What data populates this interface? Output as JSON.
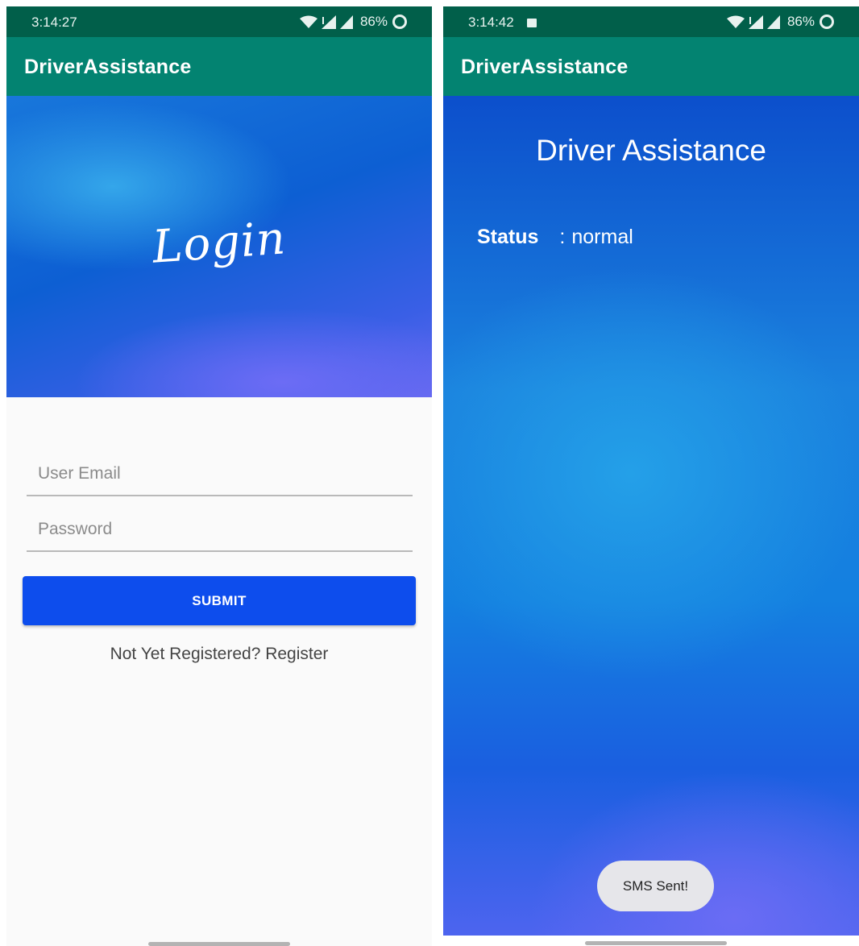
{
  "left_screen": {
    "status_bar": {
      "time": "3:14:27",
      "battery": "86%"
    },
    "app_title": "DriverAssistance",
    "hero_title": "Login",
    "email_placeholder": "User Email",
    "password_placeholder": "Password",
    "submit_label": "SUBMIT",
    "register_link": "Not Yet Registered? Register"
  },
  "right_screen": {
    "status_bar": {
      "time": "3:14:42",
      "battery": "86%"
    },
    "app_title": "DriverAssistance",
    "screen_title": "Driver Assistance",
    "status_label": "Status",
    "status_separator": ":",
    "status_value": "normal",
    "toast": "SMS Sent!"
  },
  "icons": [
    "wifi-icon",
    "signal-icon",
    "battery-icon",
    "image-notification-icon"
  ],
  "colors": {
    "status_bar": "#015f4a",
    "app_bar": "#038371",
    "submit_button": "#0d4ded",
    "background_blue": "#1480e0"
  }
}
